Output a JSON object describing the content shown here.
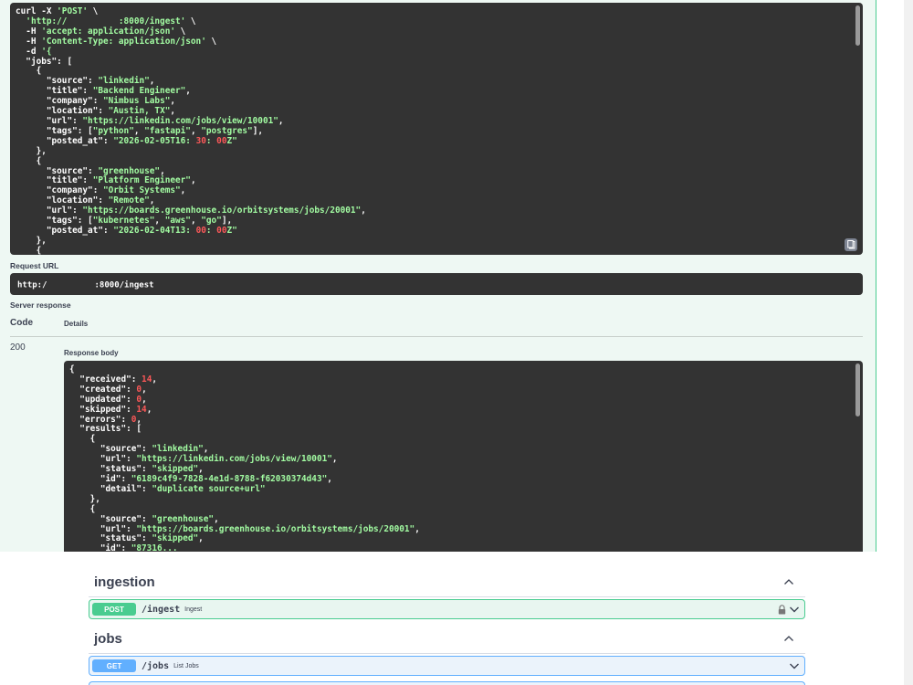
{
  "curl_block": {
    "lines": [
      "curl -X 'POST' \\",
      "  'http://          :8000/ingest' \\",
      "  -H 'accept: application/json' \\",
      "  -H 'Content-Type: application/json' \\",
      "  -d '{",
      "  \"jobs\": [",
      "    {",
      "      \"source\": \"linkedin\",",
      "      \"title\": \"Backend Engineer\",",
      "      \"company\": \"Nimbus Labs\",",
      "      \"location\": \"Austin, TX\",",
      "      \"url\": \"https://linkedin.com/jobs/view/10001\",",
      "      \"tags\": [\"python\", \"fastapi\", \"postgres\"],",
      "      \"posted_at\": \"2026-02-05T16:30:00Z\"",
      "    },",
      "    {",
      "      \"source\": \"greenhouse\",",
      "      \"title\": \"Platform Engineer\",",
      "      \"company\": \"Orbit Systems\",",
      "      \"location\": \"Remote\",",
      "      \"url\": \"https://boards.greenhouse.io/orbitsystems/jobs/20001\",",
      "      \"tags\": [\"kubernetes\", \"aws\", \"go\"],",
      "      \"posted_at\": \"2026-02-04T13:00:00Z\"",
      "    },",
      "    {"
    ]
  },
  "request_url": {
    "label": "Request URL",
    "prefix": "http:/",
    "suffix": ":8000/ingest"
  },
  "server_response": {
    "label": "Server response",
    "col_code": "Code",
    "col_details": "Details",
    "code": "200",
    "body_label": "Response body",
    "body_lines": [
      "{",
      "  \"received\": 14,",
      "  \"created\": 0,",
      "  \"updated\": 0,",
      "  \"skipped\": 14,",
      "  \"errors\": 0,",
      "  \"results\": [",
      "    {",
      "      \"source\": \"linkedin\",",
      "      \"url\": \"https://linkedin.com/jobs/view/10001\",",
      "      \"status\": \"skipped\",",
      "      \"id\": \"6189c4f9-7828-4e1d-8788-f62030374d43\",",
      "      \"detail\": \"duplicate source+url\"",
      "    },",
      "    {",
      "      \"source\": \"greenhouse\",",
      "      \"url\": \"https://boards.greenhouse.io/orbitsystems/jobs/20001\",",
      "      \"status\": \"skipped\",",
      "      \"id\": \"87316..."
    ]
  },
  "sections": [
    {
      "title": "ingestion",
      "operation": {
        "method": "POST",
        "path": "/ingest",
        "summary": "Ingest",
        "locked": true
      }
    },
    {
      "title": "jobs",
      "operation": {
        "method": "GET",
        "path": "/jobs",
        "summary": "List Jobs",
        "locked": false
      }
    }
  ],
  "colors": {
    "post": "#49cc90",
    "get": "#61affe",
    "code_bg": "#333333",
    "string": "#a2fca2",
    "number": "#fc5858"
  }
}
